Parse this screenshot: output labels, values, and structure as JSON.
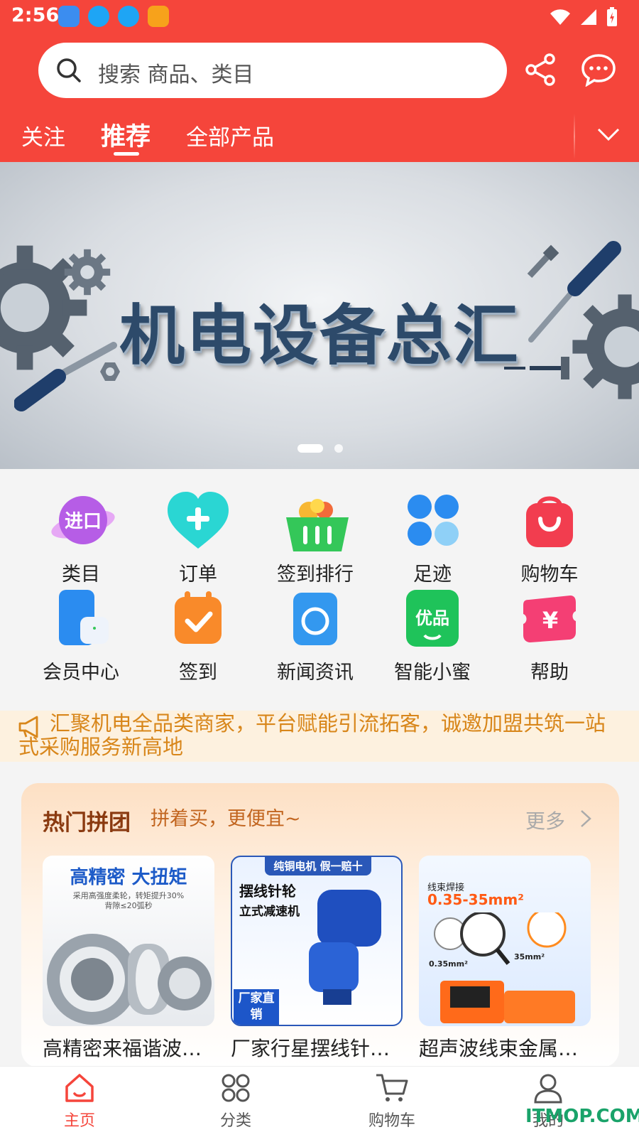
{
  "status_bar": {
    "time": "2:56",
    "app_icons": [
      "cloud-app-icon",
      "download-icon",
      "download-icon",
      "shop-app-icon"
    ],
    "indicators": [
      "wifi-icon",
      "signal-icon",
      "battery-charging-icon"
    ]
  },
  "search": {
    "placeholder": "搜索 商品、类目"
  },
  "header_icons": [
    "share-icon",
    "message-icon"
  ],
  "tabs": [
    {
      "label": "关注",
      "active": false
    },
    {
      "label": "推荐",
      "active": true
    },
    {
      "label": "全部产品",
      "active": false
    }
  ],
  "banner": {
    "title": "机电设备总汇",
    "page_count": 2,
    "current_page": 1
  },
  "grid": [
    {
      "label": "类目",
      "icon": "import-planet-icon"
    },
    {
      "label": "订单",
      "icon": "heart-plus-icon"
    },
    {
      "label": "签到排行",
      "icon": "fruit-basket-icon"
    },
    {
      "label": "足迹",
      "icon": "four-petal-icon"
    },
    {
      "label": "购物车",
      "icon": "shopping-bag-icon"
    },
    {
      "label": "会员中心",
      "icon": "phone-earbuds-icon"
    },
    {
      "label": "签到",
      "icon": "calendar-check-icon"
    },
    {
      "label": "新闻资讯",
      "icon": "camera-lens-icon"
    },
    {
      "label": "智能小蜜",
      "icon": "youpin-icon"
    },
    {
      "label": "帮助",
      "icon": "yen-ticket-icon"
    }
  ],
  "notice": {
    "text": "汇聚机电全品类商家，平台赋能引流拓客，诚邀加盟共筑一站式采购服务新高地"
  },
  "hot_group": {
    "title": "热门拼团",
    "subtitle": "拼着买，更便宜~",
    "more": "更多",
    "products": [
      {
        "name": "高精密来福谐波…",
        "img_headline": "高精密 大扭矩",
        "img_sub": "采用高强度柔轮，转矩提升30%",
        "img_sub2": "背隙≤20弧秒"
      },
      {
        "name": "厂家行星摆线针…",
        "img_headline": "纯铜电机 假一赔十",
        "img_sub": "摆线针轮",
        "img_sub2": "立式减速机",
        "img_tag": "厂家直销"
      },
      {
        "name": "超声波线束金属…",
        "img_headline": "线束焊接",
        "img_sub": "0.35-35mm²",
        "img_sub2": "0.35mm²",
        "img_sub3": "35mm²"
      }
    ]
  },
  "bottom_nav": [
    {
      "label": "主页",
      "icon": "home-icon",
      "active": true
    },
    {
      "label": "分类",
      "icon": "category-icon",
      "active": false
    },
    {
      "label": "购物车",
      "icon": "cart-icon",
      "active": false
    },
    {
      "label": "我的",
      "icon": "user-icon",
      "active": false
    }
  ],
  "watermark": "ITMOP.COM",
  "colors": {
    "brand": "#f5453b",
    "notice_text": "#d8861a",
    "hot_title": "#8a3a10",
    "nav_active": "#f5453b"
  }
}
